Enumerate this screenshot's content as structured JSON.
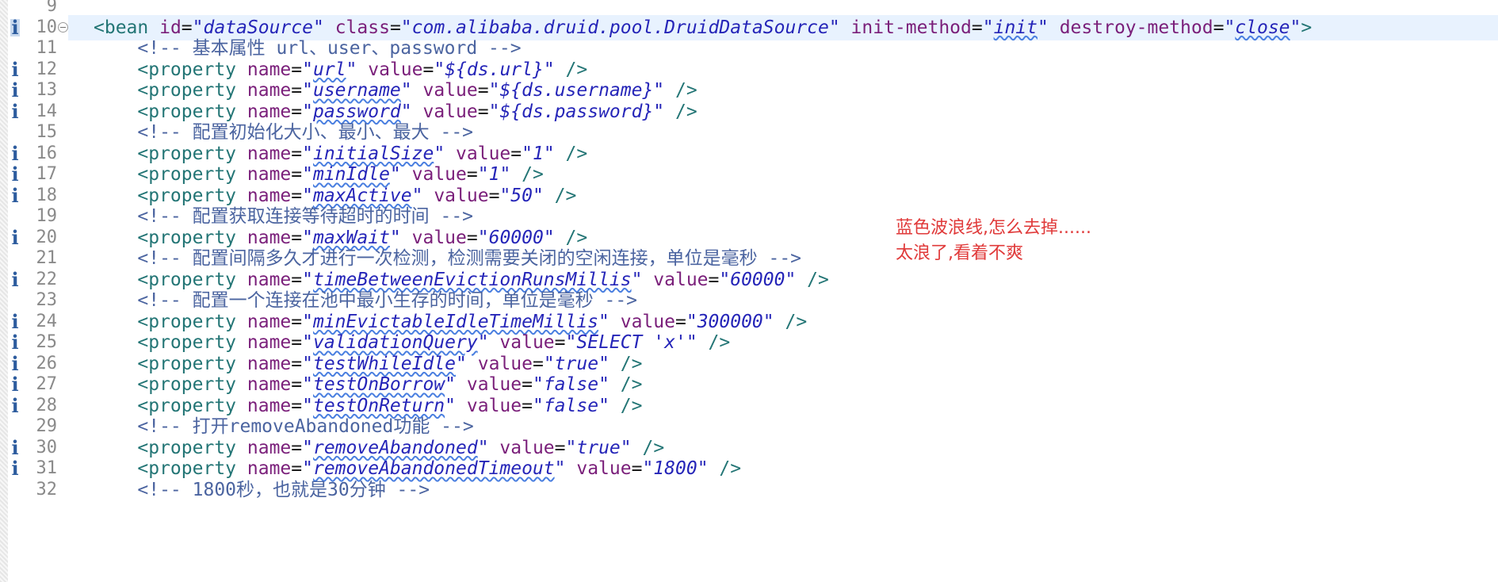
{
  "editor": {
    "current_line": "10",
    "lines": [
      {
        "no": "9",
        "tokens": []
      },
      {
        "no": "10",
        "info": true,
        "fold": true,
        "tokens": [
          {
            "t": "<bean ",
            "c": "tag"
          },
          {
            "t": "id",
            "c": "attr"
          },
          {
            "t": "=",
            "c": "eq"
          },
          {
            "t": "\"dataSource\"",
            "c": "val"
          },
          {
            "t": " "
          },
          {
            "t": "class",
            "c": "attr"
          },
          {
            "t": "=",
            "c": "eq"
          },
          {
            "t": "\"com.alibaba.druid.pool.DruidDataSource\"",
            "c": "val"
          },
          {
            "t": " "
          },
          {
            "t": "init-method",
            "c": "attr"
          },
          {
            "t": "=",
            "c": "eq"
          },
          {
            "t": "\"",
            "c": "val"
          },
          {
            "t": "init",
            "c": "val sq"
          },
          {
            "t": "\"",
            "c": "val"
          },
          {
            "t": " "
          },
          {
            "t": "destroy-method",
            "c": "attr"
          },
          {
            "t": "=",
            "c": "eq"
          },
          {
            "t": "\"",
            "c": "val"
          },
          {
            "t": "close",
            "c": "val sq"
          },
          {
            "t": "\"",
            "c": "val"
          },
          {
            "t": ">",
            "c": "tag"
          }
        ]
      },
      {
        "no": "11",
        "tokens": [
          {
            "t": "    "
          },
          {
            "t": "<!-- 基本属性 url、user、password -->",
            "c": "cmt"
          }
        ]
      },
      {
        "no": "12",
        "info": true,
        "tokens": [
          {
            "t": "    "
          },
          {
            "t": "<property ",
            "c": "tag"
          },
          {
            "t": "name",
            "c": "attr"
          },
          {
            "t": "=",
            "c": "eq"
          },
          {
            "t": "\"",
            "c": "val"
          },
          {
            "t": "url",
            "c": "val sq"
          },
          {
            "t": "\"",
            "c": "val"
          },
          {
            "t": " "
          },
          {
            "t": "value",
            "c": "attr"
          },
          {
            "t": "=",
            "c": "eq"
          },
          {
            "t": "\"${ds.url}\"",
            "c": "val"
          },
          {
            "t": " />",
            "c": "tag"
          }
        ]
      },
      {
        "no": "13",
        "info": true,
        "tokens": [
          {
            "t": "    "
          },
          {
            "t": "<property ",
            "c": "tag"
          },
          {
            "t": "name",
            "c": "attr"
          },
          {
            "t": "=",
            "c": "eq"
          },
          {
            "t": "\"",
            "c": "val"
          },
          {
            "t": "username",
            "c": "val sq"
          },
          {
            "t": "\"",
            "c": "val"
          },
          {
            "t": " "
          },
          {
            "t": "value",
            "c": "attr"
          },
          {
            "t": "=",
            "c": "eq"
          },
          {
            "t": "\"${ds.username}\"",
            "c": "val"
          },
          {
            "t": " />",
            "c": "tag"
          }
        ]
      },
      {
        "no": "14",
        "info": true,
        "tokens": [
          {
            "t": "    "
          },
          {
            "t": "<property ",
            "c": "tag"
          },
          {
            "t": "name",
            "c": "attr"
          },
          {
            "t": "=",
            "c": "eq"
          },
          {
            "t": "\"",
            "c": "val"
          },
          {
            "t": "password",
            "c": "val sq"
          },
          {
            "t": "\"",
            "c": "val"
          },
          {
            "t": " "
          },
          {
            "t": "value",
            "c": "attr"
          },
          {
            "t": "=",
            "c": "eq"
          },
          {
            "t": "\"${ds.password}\"",
            "c": "val"
          },
          {
            "t": " />",
            "c": "tag"
          }
        ]
      },
      {
        "no": "15",
        "tokens": [
          {
            "t": "    "
          },
          {
            "t": "<!-- 配置初始化大小、最小、最大 -->",
            "c": "cmt"
          }
        ]
      },
      {
        "no": "16",
        "info": true,
        "tokens": [
          {
            "t": "    "
          },
          {
            "t": "<property ",
            "c": "tag"
          },
          {
            "t": "name",
            "c": "attr"
          },
          {
            "t": "=",
            "c": "eq"
          },
          {
            "t": "\"",
            "c": "val"
          },
          {
            "t": "initialSize",
            "c": "val sq"
          },
          {
            "t": "\"",
            "c": "val"
          },
          {
            "t": " "
          },
          {
            "t": "value",
            "c": "attr"
          },
          {
            "t": "=",
            "c": "eq"
          },
          {
            "t": "\"1\"",
            "c": "val"
          },
          {
            "t": " />",
            "c": "tag"
          }
        ]
      },
      {
        "no": "17",
        "info": true,
        "tokens": [
          {
            "t": "    "
          },
          {
            "t": "<property ",
            "c": "tag"
          },
          {
            "t": "name",
            "c": "attr"
          },
          {
            "t": "=",
            "c": "eq"
          },
          {
            "t": "\"",
            "c": "val"
          },
          {
            "t": "minIdle",
            "c": "val sq"
          },
          {
            "t": "\"",
            "c": "val"
          },
          {
            "t": " "
          },
          {
            "t": "value",
            "c": "attr"
          },
          {
            "t": "=",
            "c": "eq"
          },
          {
            "t": "\"1\"",
            "c": "val"
          },
          {
            "t": " />",
            "c": "tag"
          }
        ]
      },
      {
        "no": "18",
        "info": true,
        "tokens": [
          {
            "t": "    "
          },
          {
            "t": "<property ",
            "c": "tag"
          },
          {
            "t": "name",
            "c": "attr"
          },
          {
            "t": "=",
            "c": "eq"
          },
          {
            "t": "\"",
            "c": "val"
          },
          {
            "t": "maxActive",
            "c": "val sq"
          },
          {
            "t": "\"",
            "c": "val"
          },
          {
            "t": " "
          },
          {
            "t": "value",
            "c": "attr"
          },
          {
            "t": "=",
            "c": "eq"
          },
          {
            "t": "\"50\"",
            "c": "val"
          },
          {
            "t": " />",
            "c": "tag"
          }
        ]
      },
      {
        "no": "19",
        "tokens": [
          {
            "t": "    "
          },
          {
            "t": "<!-- 配置获取连接等待超时的时间 -->",
            "c": "cmt"
          }
        ]
      },
      {
        "no": "20",
        "info": true,
        "tokens": [
          {
            "t": "    "
          },
          {
            "t": "<property ",
            "c": "tag"
          },
          {
            "t": "name",
            "c": "attr"
          },
          {
            "t": "=",
            "c": "eq"
          },
          {
            "t": "\"",
            "c": "val"
          },
          {
            "t": "maxWait",
            "c": "val sq"
          },
          {
            "t": "\"",
            "c": "val"
          },
          {
            "t": " "
          },
          {
            "t": "value",
            "c": "attr"
          },
          {
            "t": "=",
            "c": "eq"
          },
          {
            "t": "\"60000\"",
            "c": "val"
          },
          {
            "t": " />",
            "c": "tag"
          }
        ]
      },
      {
        "no": "21",
        "tokens": [
          {
            "t": "    "
          },
          {
            "t": "<!-- 配置间隔多久才进行一次检测，检测需要关闭的空闲连接，单位是毫秒 -->",
            "c": "cmt"
          }
        ]
      },
      {
        "no": "22",
        "info": true,
        "tokens": [
          {
            "t": "    "
          },
          {
            "t": "<property ",
            "c": "tag"
          },
          {
            "t": "name",
            "c": "attr"
          },
          {
            "t": "=",
            "c": "eq"
          },
          {
            "t": "\"",
            "c": "val"
          },
          {
            "t": "timeBetweenEvictionRunsMillis",
            "c": "val sq"
          },
          {
            "t": "\"",
            "c": "val"
          },
          {
            "t": " "
          },
          {
            "t": "value",
            "c": "attr"
          },
          {
            "t": "=",
            "c": "eq"
          },
          {
            "t": "\"60000\"",
            "c": "val"
          },
          {
            "t": " />",
            "c": "tag"
          }
        ]
      },
      {
        "no": "23",
        "tokens": [
          {
            "t": "    "
          },
          {
            "t": "<!-- 配置一个连接在池中最小生存的时间，单位是毫秒 -->",
            "c": "cmt"
          }
        ]
      },
      {
        "no": "24",
        "info": true,
        "tokens": [
          {
            "t": "    "
          },
          {
            "t": "<property ",
            "c": "tag"
          },
          {
            "t": "name",
            "c": "attr"
          },
          {
            "t": "=",
            "c": "eq"
          },
          {
            "t": "\"",
            "c": "val"
          },
          {
            "t": "minEvictableIdleTimeMillis",
            "c": "val sq"
          },
          {
            "t": "\"",
            "c": "val"
          },
          {
            "t": " "
          },
          {
            "t": "value",
            "c": "attr"
          },
          {
            "t": "=",
            "c": "eq"
          },
          {
            "t": "\"300000\"",
            "c": "val"
          },
          {
            "t": " />",
            "c": "tag"
          }
        ]
      },
      {
        "no": "25",
        "info": true,
        "tokens": [
          {
            "t": "    "
          },
          {
            "t": "<property ",
            "c": "tag"
          },
          {
            "t": "name",
            "c": "attr"
          },
          {
            "t": "=",
            "c": "eq"
          },
          {
            "t": "\"",
            "c": "val"
          },
          {
            "t": "validationQuery",
            "c": "val sq"
          },
          {
            "t": "\"",
            "c": "val"
          },
          {
            "t": " "
          },
          {
            "t": "value",
            "c": "attr"
          },
          {
            "t": "=",
            "c": "eq"
          },
          {
            "t": "\"SELECT 'x'\"",
            "c": "val"
          },
          {
            "t": " />",
            "c": "tag"
          }
        ]
      },
      {
        "no": "26",
        "info": true,
        "tokens": [
          {
            "t": "    "
          },
          {
            "t": "<property ",
            "c": "tag"
          },
          {
            "t": "name",
            "c": "attr"
          },
          {
            "t": "=",
            "c": "eq"
          },
          {
            "t": "\"",
            "c": "val"
          },
          {
            "t": "testWhileIdle",
            "c": "val sq"
          },
          {
            "t": "\"",
            "c": "val"
          },
          {
            "t": " "
          },
          {
            "t": "value",
            "c": "attr"
          },
          {
            "t": "=",
            "c": "eq"
          },
          {
            "t": "\"true\"",
            "c": "val"
          },
          {
            "t": " />",
            "c": "tag"
          }
        ]
      },
      {
        "no": "27",
        "info": true,
        "tokens": [
          {
            "t": "    "
          },
          {
            "t": "<property ",
            "c": "tag"
          },
          {
            "t": "name",
            "c": "attr"
          },
          {
            "t": "=",
            "c": "eq"
          },
          {
            "t": "\"",
            "c": "val"
          },
          {
            "t": "testOnBorrow",
            "c": "val sq"
          },
          {
            "t": "\"",
            "c": "val"
          },
          {
            "t": " "
          },
          {
            "t": "value",
            "c": "attr"
          },
          {
            "t": "=",
            "c": "eq"
          },
          {
            "t": "\"false\"",
            "c": "val"
          },
          {
            "t": " />",
            "c": "tag"
          }
        ]
      },
      {
        "no": "28",
        "info": true,
        "tokens": [
          {
            "t": "    "
          },
          {
            "t": "<property ",
            "c": "tag"
          },
          {
            "t": "name",
            "c": "attr"
          },
          {
            "t": "=",
            "c": "eq"
          },
          {
            "t": "\"",
            "c": "val"
          },
          {
            "t": "testOnReturn",
            "c": "val sq"
          },
          {
            "t": "\"",
            "c": "val"
          },
          {
            "t": " "
          },
          {
            "t": "value",
            "c": "attr"
          },
          {
            "t": "=",
            "c": "eq"
          },
          {
            "t": "\"false\"",
            "c": "val"
          },
          {
            "t": " />",
            "c": "tag"
          }
        ]
      },
      {
        "no": "29",
        "tokens": [
          {
            "t": "    "
          },
          {
            "t": "<!-- 打开removeAbandoned功能 -->",
            "c": "cmt"
          }
        ]
      },
      {
        "no": "30",
        "info": true,
        "tokens": [
          {
            "t": "    "
          },
          {
            "t": "<property ",
            "c": "tag"
          },
          {
            "t": "name",
            "c": "attr"
          },
          {
            "t": "=",
            "c": "eq"
          },
          {
            "t": "\"",
            "c": "val"
          },
          {
            "t": "removeAbandoned",
            "c": "val sq"
          },
          {
            "t": "\"",
            "c": "val"
          },
          {
            "t": " "
          },
          {
            "t": "value",
            "c": "attr"
          },
          {
            "t": "=",
            "c": "eq"
          },
          {
            "t": "\"true\"",
            "c": "val"
          },
          {
            "t": " />",
            "c": "tag"
          }
        ]
      },
      {
        "no": "31",
        "info": true,
        "tokens": [
          {
            "t": "    "
          },
          {
            "t": "<property ",
            "c": "tag"
          },
          {
            "t": "name",
            "c": "attr"
          },
          {
            "t": "=",
            "c": "eq"
          },
          {
            "t": "\"",
            "c": "val"
          },
          {
            "t": "removeAbandonedTimeout",
            "c": "val sq"
          },
          {
            "t": "\"",
            "c": "val"
          },
          {
            "t": " "
          },
          {
            "t": "value",
            "c": "attr"
          },
          {
            "t": "=",
            "c": "eq"
          },
          {
            "t": "\"1800\"",
            "c": "val"
          },
          {
            "t": " />",
            "c": "tag"
          }
        ]
      },
      {
        "no": "32",
        "tokens": [
          {
            "t": "    "
          },
          {
            "t": "<!-- 1800秒，也就是30分钟 -->",
            "c": "cmt"
          }
        ]
      }
    ]
  },
  "annotation": {
    "line1": "蓝色波浪线,怎么去掉......",
    "line2": "太浪了,看着不爽"
  },
  "colors": {
    "tag": "#237575",
    "attribute": "#7a1f7a",
    "value": "#2525b8",
    "comment": "#4b64a0",
    "squiggle": "#4a7fe0",
    "annotation": "#e03a3a",
    "current_line": "#e8f2fe"
  },
  "icons": {
    "info": "info-icon",
    "fold": "fold-collapse-icon"
  },
  "gutter_glyph": "i"
}
